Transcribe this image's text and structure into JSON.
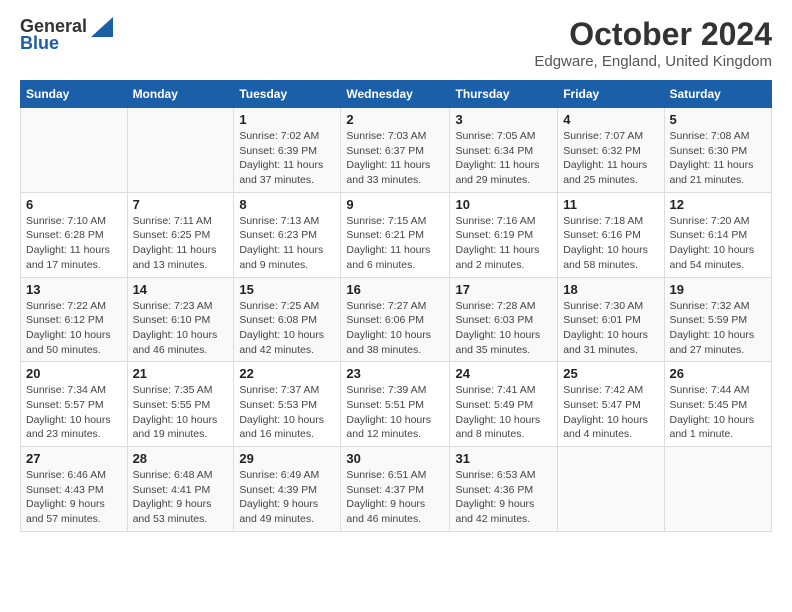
{
  "logo": {
    "general": "General",
    "blue": "Blue"
  },
  "title": "October 2024",
  "location": "Edgware, England, United Kingdom",
  "days_header": [
    "Sunday",
    "Monday",
    "Tuesday",
    "Wednesday",
    "Thursday",
    "Friday",
    "Saturday"
  ],
  "weeks": [
    [
      {
        "day": "",
        "info": ""
      },
      {
        "day": "",
        "info": ""
      },
      {
        "day": "1",
        "info": "Sunrise: 7:02 AM\nSunset: 6:39 PM\nDaylight: 11 hours and 37 minutes."
      },
      {
        "day": "2",
        "info": "Sunrise: 7:03 AM\nSunset: 6:37 PM\nDaylight: 11 hours and 33 minutes."
      },
      {
        "day": "3",
        "info": "Sunrise: 7:05 AM\nSunset: 6:34 PM\nDaylight: 11 hours and 29 minutes."
      },
      {
        "day": "4",
        "info": "Sunrise: 7:07 AM\nSunset: 6:32 PM\nDaylight: 11 hours and 25 minutes."
      },
      {
        "day": "5",
        "info": "Sunrise: 7:08 AM\nSunset: 6:30 PM\nDaylight: 11 hours and 21 minutes."
      }
    ],
    [
      {
        "day": "6",
        "info": "Sunrise: 7:10 AM\nSunset: 6:28 PM\nDaylight: 11 hours and 17 minutes."
      },
      {
        "day": "7",
        "info": "Sunrise: 7:11 AM\nSunset: 6:25 PM\nDaylight: 11 hours and 13 minutes."
      },
      {
        "day": "8",
        "info": "Sunrise: 7:13 AM\nSunset: 6:23 PM\nDaylight: 11 hours and 9 minutes."
      },
      {
        "day": "9",
        "info": "Sunrise: 7:15 AM\nSunset: 6:21 PM\nDaylight: 11 hours and 6 minutes."
      },
      {
        "day": "10",
        "info": "Sunrise: 7:16 AM\nSunset: 6:19 PM\nDaylight: 11 hours and 2 minutes."
      },
      {
        "day": "11",
        "info": "Sunrise: 7:18 AM\nSunset: 6:16 PM\nDaylight: 10 hours and 58 minutes."
      },
      {
        "day": "12",
        "info": "Sunrise: 7:20 AM\nSunset: 6:14 PM\nDaylight: 10 hours and 54 minutes."
      }
    ],
    [
      {
        "day": "13",
        "info": "Sunrise: 7:22 AM\nSunset: 6:12 PM\nDaylight: 10 hours and 50 minutes."
      },
      {
        "day": "14",
        "info": "Sunrise: 7:23 AM\nSunset: 6:10 PM\nDaylight: 10 hours and 46 minutes."
      },
      {
        "day": "15",
        "info": "Sunrise: 7:25 AM\nSunset: 6:08 PM\nDaylight: 10 hours and 42 minutes."
      },
      {
        "day": "16",
        "info": "Sunrise: 7:27 AM\nSunset: 6:06 PM\nDaylight: 10 hours and 38 minutes."
      },
      {
        "day": "17",
        "info": "Sunrise: 7:28 AM\nSunset: 6:03 PM\nDaylight: 10 hours and 35 minutes."
      },
      {
        "day": "18",
        "info": "Sunrise: 7:30 AM\nSunset: 6:01 PM\nDaylight: 10 hours and 31 minutes."
      },
      {
        "day": "19",
        "info": "Sunrise: 7:32 AM\nSunset: 5:59 PM\nDaylight: 10 hours and 27 minutes."
      }
    ],
    [
      {
        "day": "20",
        "info": "Sunrise: 7:34 AM\nSunset: 5:57 PM\nDaylight: 10 hours and 23 minutes."
      },
      {
        "day": "21",
        "info": "Sunrise: 7:35 AM\nSunset: 5:55 PM\nDaylight: 10 hours and 19 minutes."
      },
      {
        "day": "22",
        "info": "Sunrise: 7:37 AM\nSunset: 5:53 PM\nDaylight: 10 hours and 16 minutes."
      },
      {
        "day": "23",
        "info": "Sunrise: 7:39 AM\nSunset: 5:51 PM\nDaylight: 10 hours and 12 minutes."
      },
      {
        "day": "24",
        "info": "Sunrise: 7:41 AM\nSunset: 5:49 PM\nDaylight: 10 hours and 8 minutes."
      },
      {
        "day": "25",
        "info": "Sunrise: 7:42 AM\nSunset: 5:47 PM\nDaylight: 10 hours and 4 minutes."
      },
      {
        "day": "26",
        "info": "Sunrise: 7:44 AM\nSunset: 5:45 PM\nDaylight: 10 hours and 1 minute."
      }
    ],
    [
      {
        "day": "27",
        "info": "Sunrise: 6:46 AM\nSunset: 4:43 PM\nDaylight: 9 hours and 57 minutes."
      },
      {
        "day": "28",
        "info": "Sunrise: 6:48 AM\nSunset: 4:41 PM\nDaylight: 9 hours and 53 minutes."
      },
      {
        "day": "29",
        "info": "Sunrise: 6:49 AM\nSunset: 4:39 PM\nDaylight: 9 hours and 49 minutes."
      },
      {
        "day": "30",
        "info": "Sunrise: 6:51 AM\nSunset: 4:37 PM\nDaylight: 9 hours and 46 minutes."
      },
      {
        "day": "31",
        "info": "Sunrise: 6:53 AM\nSunset: 4:36 PM\nDaylight: 9 hours and 42 minutes."
      },
      {
        "day": "",
        "info": ""
      },
      {
        "day": "",
        "info": ""
      }
    ]
  ]
}
